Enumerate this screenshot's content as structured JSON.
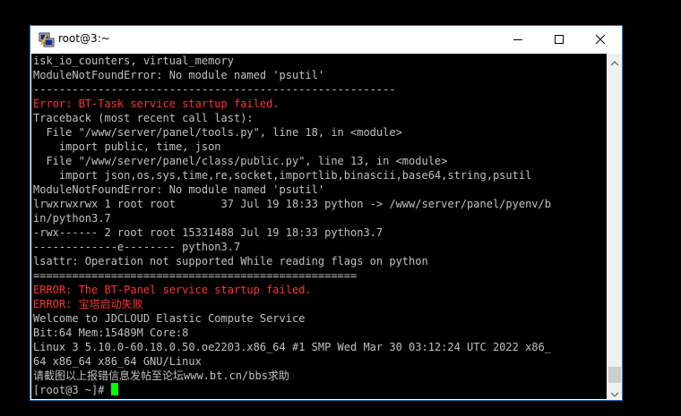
{
  "window": {
    "title": "root@3:~"
  },
  "terminal": {
    "lines": [
      {
        "text": "isk_io_counters, virtual_memory",
        "color": "normal"
      },
      {
        "text": "ModuleNotFoundError: No module named 'psutil'",
        "color": "normal"
      },
      {
        "text": "--------------------------------------------------------",
        "color": "normal"
      },
      {
        "text": "Error: BT-Task service startup failed.",
        "color": "red"
      },
      {
        "text": "Traceback (most recent call last):",
        "color": "normal"
      },
      {
        "text": "  File \"/www/server/panel/tools.py\", line 18, in <module>",
        "color": "normal"
      },
      {
        "text": "    import public, time, json",
        "color": "normal"
      },
      {
        "text": "  File \"/www/server/panel/class/public.py\", line 13, in <module>",
        "color": "normal"
      },
      {
        "text": "    import json,os,sys,time,re,socket,importlib,binascii,base64,string,psutil",
        "color": "normal"
      },
      {
        "text": "ModuleNotFoundError: No module named 'psutil'",
        "color": "normal"
      },
      {
        "text": "lrwxrwxrwx 1 root root       37 Jul 19 18:33 python -> /www/server/panel/pyenv/b",
        "color": "normal"
      },
      {
        "text": "in/python3.7",
        "color": "normal"
      },
      {
        "text": "-rwx------ 2 root root 15331488 Jul 19 18:33 python3.7",
        "color": "normal"
      },
      {
        "text": "-------------e-------- python3.7",
        "color": "normal"
      },
      {
        "text": "lsattr: Operation not supported While reading flags on python",
        "color": "normal"
      },
      {
        "text": "==================================================",
        "color": "normal"
      },
      {
        "text": "ERROR: The BT-Panel service startup failed.",
        "color": "red"
      },
      {
        "text": "ERROR: 宝塔启动失败",
        "color": "red"
      },
      {
        "text": "Welcome to JDCLOUD Elastic Compute Service",
        "color": "normal"
      },
      {
        "text": "Bit:64 Mem:15489M Core:8",
        "color": "normal"
      },
      {
        "text": "Linux 3 5.10.0-60.18.0.50.oe2203.x86_64 #1 SMP Wed Mar 30 03:12:24 UTC 2022 x86_",
        "color": "normal"
      },
      {
        "text": "64 x86_64 x86_64 GNU/Linux",
        "color": "normal"
      },
      {
        "text": "请截图以上报错信息发帖至论坛www.bt.cn/bbs求助",
        "color": "normal"
      }
    ],
    "prompt": "[root@3 ~]# "
  },
  "colors": {
    "normal": "#c0c0c0",
    "red": "#ff3333",
    "cursor": "#00ff00"
  },
  "icons": {
    "app": "putty-icon",
    "minimize": "minimize-icon",
    "maximize": "maximize-icon",
    "close": "close-icon"
  }
}
